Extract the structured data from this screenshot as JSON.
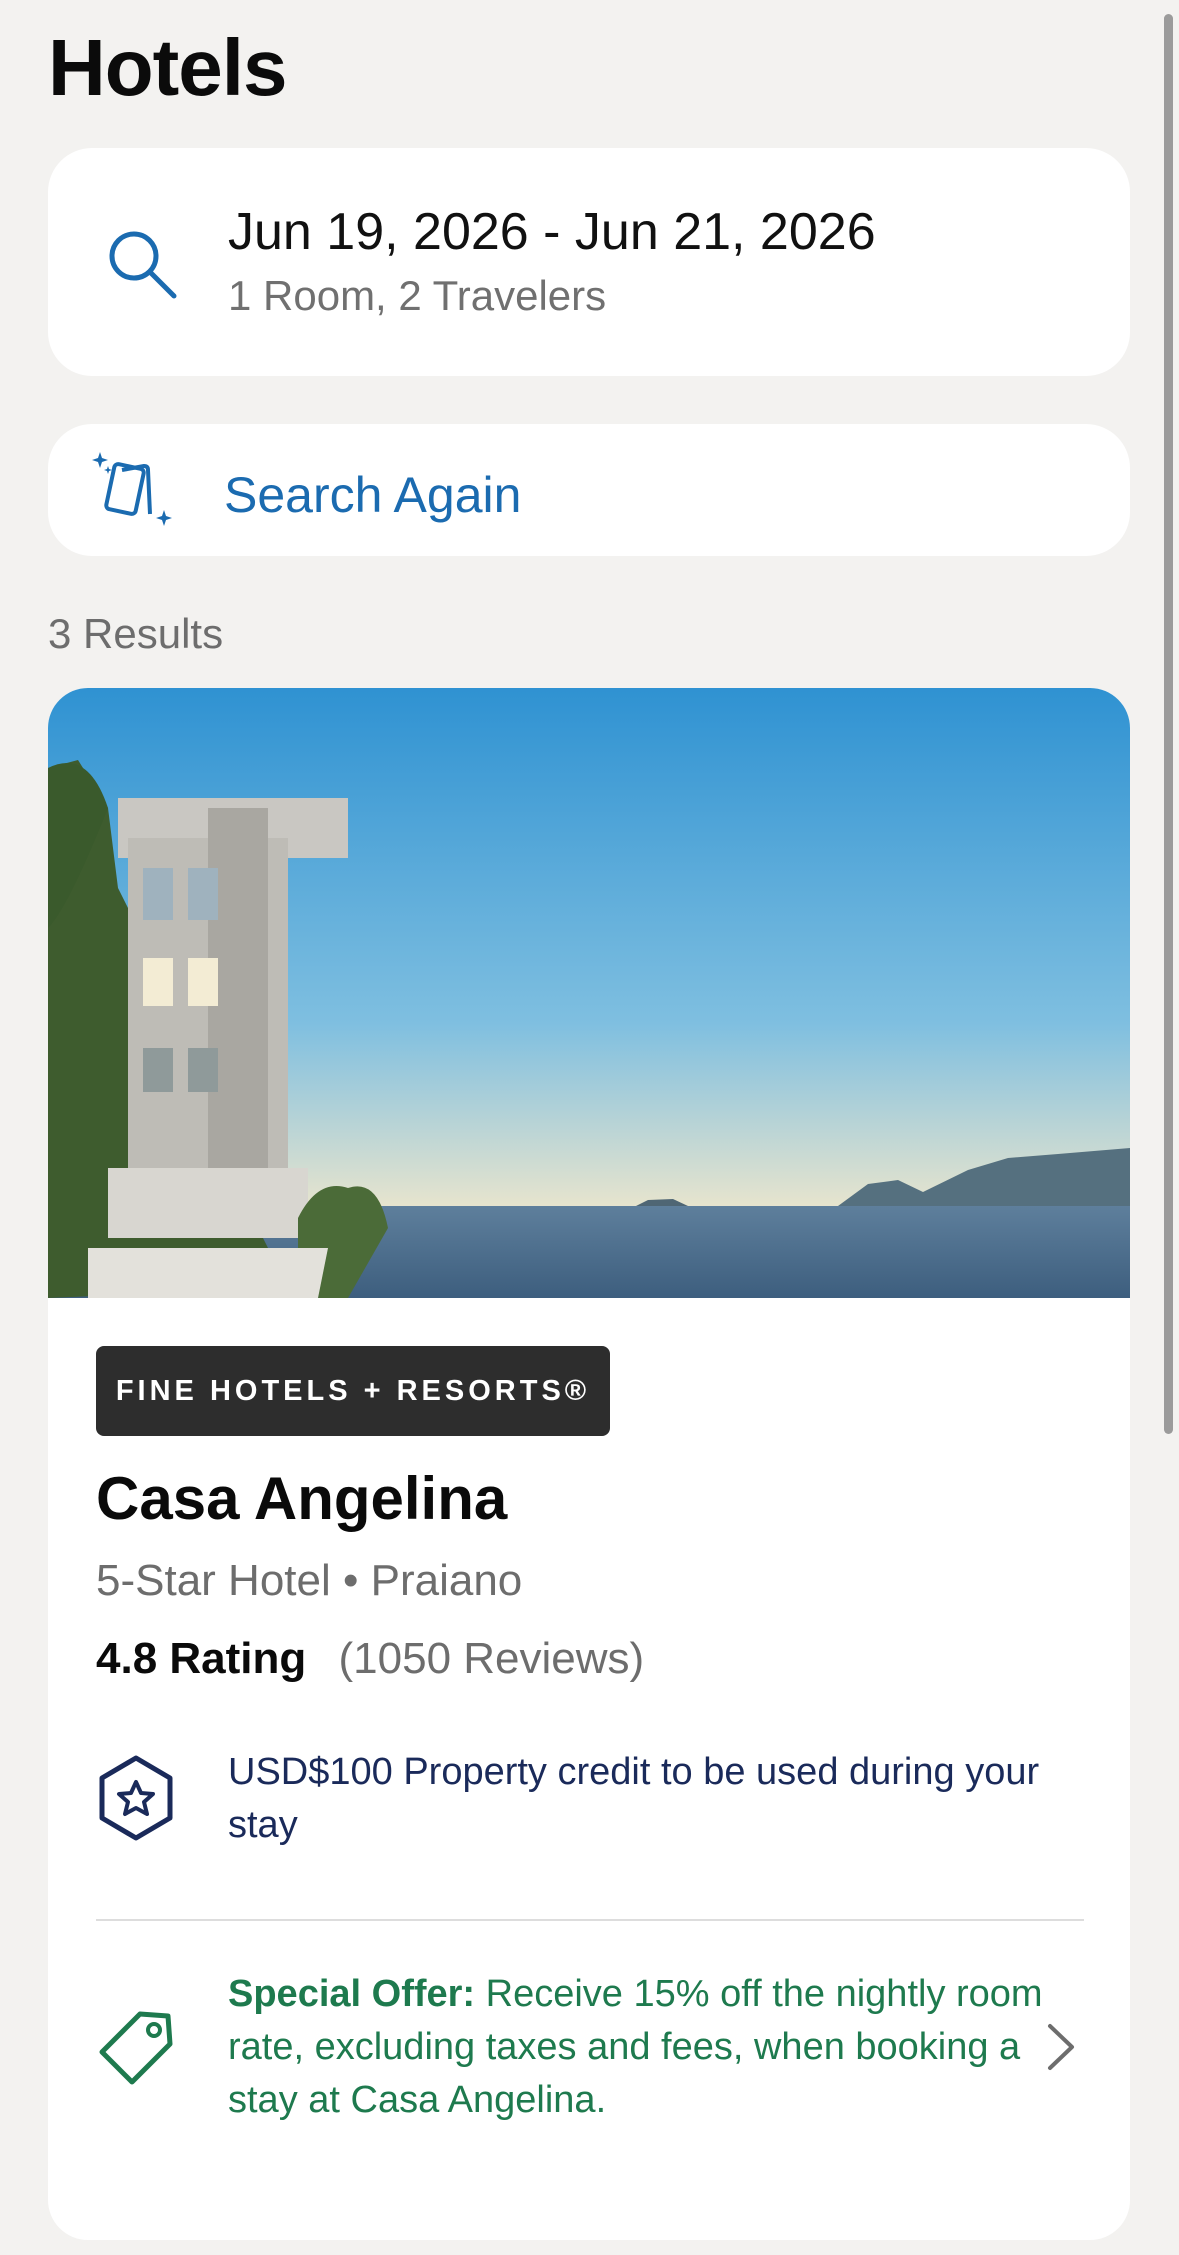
{
  "header": {
    "title": "Hotels"
  },
  "search": {
    "dates": "Jun 19, 2026 - Jun 21, 2026",
    "travelers": "1 Room, 2 Travelers",
    "icon": "search-icon"
  },
  "search_again": {
    "label": "Search Again",
    "icon": "sparkle-cards-icon"
  },
  "results": {
    "count_text": "3 Results",
    "items": [
      {
        "brand_badge": "FINE HOTELS + RESORTS®",
        "name": "Casa Angelina",
        "meta": "5-Star Hotel • Praiano",
        "rating": "4.8 Rating",
        "reviews": "(1050 Reviews)",
        "credit": "USD$100 Property credit to be used during your stay",
        "offer_label": "Special Offer:",
        "offer_text": " Receive 15% off the nightly room rate, excluding taxes and fees, when booking a stay at Casa Angelina."
      }
    ]
  },
  "colors": {
    "background": "#f3f2f0",
    "accent_blue": "#1b6bb0",
    "navy": "#1a2a5a",
    "offer_green": "#1e7a4e",
    "badge_dark": "#2d2d2d",
    "muted_text": "#6d6d6d"
  }
}
